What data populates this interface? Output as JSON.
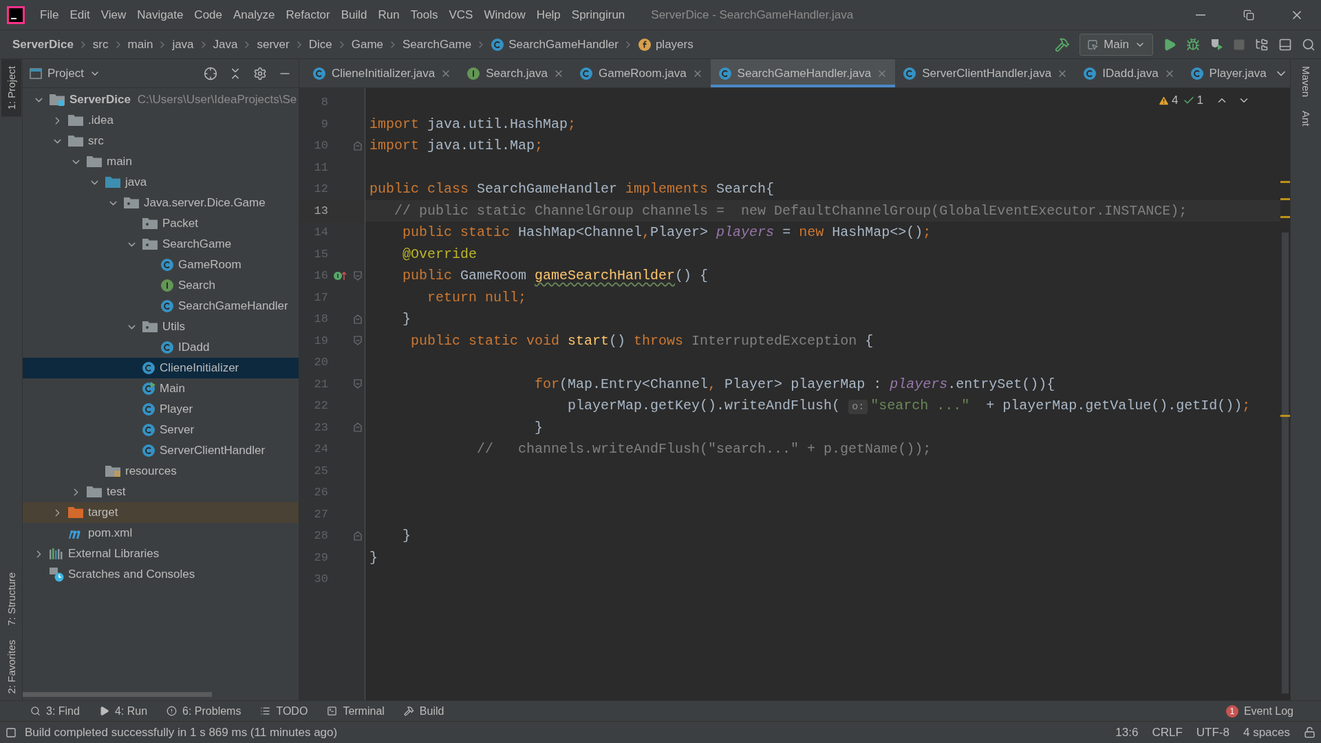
{
  "window": {
    "title": "ServerDice - SearchGameHandler.java"
  },
  "menu": [
    "File",
    "Edit",
    "View",
    "Navigate",
    "Code",
    "Analyze",
    "Refactor",
    "Build",
    "Run",
    "Tools",
    "VCS",
    "Window",
    "Help",
    "Springirun"
  ],
  "breadcrumbs": [
    {
      "label": "ServerDice",
      "kind": "project"
    },
    {
      "label": "src",
      "kind": "folder"
    },
    {
      "label": "main",
      "kind": "folder"
    },
    {
      "label": "java",
      "kind": "folder"
    },
    {
      "label": "Java",
      "kind": "folder"
    },
    {
      "label": "server",
      "kind": "folder"
    },
    {
      "label": "Dice",
      "kind": "folder"
    },
    {
      "label": "Game",
      "kind": "folder"
    },
    {
      "label": "SearchGame",
      "kind": "folder"
    },
    {
      "label": "SearchGameHandler",
      "kind": "class"
    },
    {
      "label": "players",
      "kind": "field"
    }
  ],
  "run_config": "Main",
  "left_strip": [
    {
      "label": "1: Project",
      "selected": true
    },
    {
      "label": "7: Structure",
      "selected": false
    },
    {
      "label": "2: Favorites",
      "selected": false
    }
  ],
  "right_strip": [
    "Maven",
    "Ant"
  ],
  "project_panel": {
    "title": "Project",
    "tree": [
      {
        "label": "ServerDice",
        "path": "C:\\Users\\User\\IdeaProjects\\Se",
        "kind": "module",
        "expanded": true,
        "selected": false,
        "children": [
          {
            "label": ".idea",
            "kind": "folder",
            "expanded": false,
            "selected": false
          },
          {
            "label": "src",
            "kind": "folder",
            "expanded": true,
            "selected": false,
            "children": [
              {
                "label": "main",
                "kind": "folder",
                "expanded": true,
                "selected": false,
                "children": [
                  {
                    "label": "java",
                    "kind": "source",
                    "expanded": true,
                    "selected": false,
                    "children": [
                      {
                        "label": "Java.server.Dice.Game",
                        "kind": "package",
                        "expanded": true,
                        "selected": false,
                        "children": [
                          {
                            "label": "Packet",
                            "kind": "package",
                            "selected": false
                          },
                          {
                            "label": "SearchGame",
                            "kind": "package",
                            "expanded": true,
                            "selected": false,
                            "children": [
                              {
                                "label": "GameRoom",
                                "kind": "class",
                                "selected": false
                              },
                              {
                                "label": "Search",
                                "kind": "interface",
                                "selected": false
                              },
                              {
                                "label": "SearchGameHandler",
                                "kind": "class",
                                "selected": false
                              }
                            ]
                          },
                          {
                            "label": "Utils",
                            "kind": "package",
                            "expanded": true,
                            "selected": false,
                            "children": [
                              {
                                "label": "IDadd",
                                "kind": "class",
                                "selected": false
                              }
                            ]
                          },
                          {
                            "label": "ClieneInitializer",
                            "kind": "class",
                            "selected": true
                          },
                          {
                            "label": "Main",
                            "kind": "main",
                            "selected": false
                          },
                          {
                            "label": "Player",
                            "kind": "class",
                            "selected": false
                          },
                          {
                            "label": "Server",
                            "kind": "class",
                            "selected": false
                          },
                          {
                            "label": "ServerClientHandler",
                            "kind": "class",
                            "selected": false
                          }
                        ]
                      }
                    ]
                  },
                  {
                    "label": "resources",
                    "kind": "resources",
                    "selected": false
                  }
                ]
              },
              {
                "label": "test",
                "kind": "folder",
                "expanded": false,
                "selected": false
              }
            ]
          },
          {
            "label": "target",
            "kind": "excluded",
            "expanded": false,
            "selected": false
          },
          {
            "label": "pom.xml",
            "kind": "maven",
            "selected": false
          }
        ]
      },
      {
        "label": "External Libraries",
        "kind": "libraries",
        "expanded": false,
        "selected": false
      },
      {
        "label": "Scratches and Consoles",
        "kind": "scratches",
        "selected": false
      }
    ]
  },
  "tabs": [
    {
      "label": "ClieneInitializer.java",
      "kind": "class",
      "selected": false,
      "closable": true
    },
    {
      "label": "Search.java",
      "kind": "interface",
      "selected": false,
      "closable": true
    },
    {
      "label": "GameRoom.java",
      "kind": "class",
      "selected": false,
      "closable": true
    },
    {
      "label": "SearchGameHandler.java",
      "kind": "class",
      "selected": true,
      "closable": true
    },
    {
      "label": "ServerClientHandler.java",
      "kind": "class",
      "selected": false,
      "closable": true
    },
    {
      "label": "IDadd.java",
      "kind": "class",
      "selected": false,
      "closable": true
    },
    {
      "label": "Player.java",
      "kind": "class",
      "selected": false,
      "closable": false
    }
  ],
  "editor": {
    "warnings": "4",
    "weak_warnings": "1",
    "lines": [
      {
        "number": "8",
        "current": false
      },
      {
        "number": "9",
        "current": false,
        "tokens": [
          {
            "text": "import",
            "kind": "kw"
          },
          {
            "text": " java.util.HashMap",
            "kind": "plain"
          },
          {
            "text": ";",
            "kind": "kw"
          }
        ]
      },
      {
        "number": "10",
        "current": false,
        "fold": {
          "kind": "end"
        },
        "tokens": [
          {
            "text": "import",
            "kind": "kw"
          },
          {
            "text": " java.util.Map",
            "kind": "plain"
          },
          {
            "text": ";",
            "kind": "kw"
          }
        ]
      },
      {
        "number": "11",
        "current": false
      },
      {
        "number": "12",
        "current": false,
        "tokens": [
          {
            "text": "public class",
            "kind": "kw"
          },
          {
            "text": " SearchGameHandler ",
            "kind": "plain"
          },
          {
            "text": "implements",
            "kind": "kw"
          },
          {
            "text": " Search{",
            "kind": "plain"
          }
        ]
      },
      {
        "number": "13",
        "current": true,
        "tokens": [
          {
            "text": "   // public static ChannelGroup channels =  new DefaultChannelGroup(GlobalEventExecutor.INSTANCE);",
            "kind": "comment"
          }
        ]
      },
      {
        "number": "14",
        "current": false,
        "tokens": [
          {
            "text": "    public static",
            "kind": "kw"
          },
          {
            "text": " HashMap<Channel",
            "kind": "plain"
          },
          {
            "text": ",",
            "kind": "kw"
          },
          {
            "text": "Player> ",
            "kind": "plain"
          },
          {
            "text": "players",
            "kind": "field"
          },
          {
            "text": " = ",
            "kind": "plain"
          },
          {
            "text": "new",
            "kind": "kw"
          },
          {
            "text": " HashMap<>()",
            "kind": "plain"
          },
          {
            "text": ";",
            "kind": "kw"
          }
        ]
      },
      {
        "number": "15",
        "current": false,
        "tokens": [
          {
            "text": "    @Override",
            "kind": "annotation"
          }
        ]
      },
      {
        "number": "16",
        "current": false,
        "fold": {
          "kind": "start"
        },
        "marker": {
          "kind": "implements"
        },
        "tokens": [
          {
            "text": "    public",
            "kind": "kw"
          },
          {
            "text": " GameRoom ",
            "kind": "plain"
          },
          {
            "text": "gameSearchHanlder",
            "kind": "typo-method"
          },
          {
            "text": "() {",
            "kind": "plain"
          }
        ]
      },
      {
        "number": "17",
        "current": false,
        "tokens": [
          {
            "text": "       return null;",
            "kind": "kw"
          }
        ]
      },
      {
        "number": "18",
        "current": false,
        "fold": {
          "kind": "end"
        },
        "tokens": [
          {
            "text": "    }",
            "kind": "plain"
          }
        ]
      },
      {
        "number": "19",
        "current": false,
        "fold": {
          "kind": "start"
        },
        "tokens": [
          {
            "text": "     public static void ",
            "kind": "kw"
          },
          {
            "text": "start",
            "kind": "method"
          },
          {
            "text": "() ",
            "kind": "plain"
          },
          {
            "text": "throws",
            "kind": "kw"
          },
          {
            "text": " InterruptedException",
            "kind": "muted"
          },
          {
            "text": " {",
            "kind": "plain"
          }
        ]
      },
      {
        "number": "20",
        "current": false
      },
      {
        "number": "21",
        "current": false,
        "fold": {
          "kind": "start"
        },
        "tokens": [
          {
            "text": "                    for",
            "kind": "kw"
          },
          {
            "text": "(Map.Entry<Channel",
            "kind": "plain"
          },
          {
            "text": ",",
            "kind": "kw"
          },
          {
            "text": " Player> playerMap : ",
            "kind": "plain"
          },
          {
            "text": "players",
            "kind": "field"
          },
          {
            "text": ".entrySet()){",
            "kind": "plain"
          }
        ]
      },
      {
        "number": "22",
        "current": false,
        "tokens": [
          {
            "text": "                        playerMap.getKey().writeAndFlush( ",
            "kind": "plain"
          },
          {
            "text": "o:",
            "kind": "hint"
          },
          {
            "text": "\"search ...\"",
            "kind": "string"
          },
          {
            "text": "  + playerMap.getValue().getId())",
            "kind": "plain"
          },
          {
            "text": ";",
            "kind": "kw"
          }
        ]
      },
      {
        "number": "23",
        "current": false,
        "fold": {
          "kind": "end"
        },
        "tokens": [
          {
            "text": "                    }",
            "kind": "plain"
          }
        ]
      },
      {
        "number": "24",
        "current": false,
        "tokens": [
          {
            "text": "             //   channels.writeAndFlush(\"search...\" + p.getName());",
            "kind": "comment"
          }
        ]
      },
      {
        "number": "25",
        "current": false
      },
      {
        "number": "26",
        "current": false
      },
      {
        "number": "27",
        "current": false
      },
      {
        "number": "28",
        "current": false,
        "fold": {
          "kind": "end"
        },
        "tokens": [
          {
            "text": "    }",
            "kind": "plain"
          }
        ]
      },
      {
        "number": "29",
        "current": false,
        "tokens": [
          {
            "text": "}",
            "kind": "plain"
          }
        ]
      },
      {
        "number": "30",
        "current": false
      }
    ]
  },
  "tool_windows": [
    {
      "label": "3: Find",
      "kind": "find"
    },
    {
      "label": "4: Run",
      "kind": "run"
    },
    {
      "label": "6: Problems",
      "kind": "problems"
    },
    {
      "label": "TODO",
      "kind": "todo"
    },
    {
      "label": "Terminal",
      "kind": "terminal"
    },
    {
      "label": "Build",
      "kind": "build"
    }
  ],
  "event_log": {
    "label": "Event Log",
    "count": "1"
  },
  "status_bar": {
    "message": "Build completed successfully in 1 s 869 ms (11 minutes ago)",
    "items": [
      "13:6",
      "CRLF",
      "UTF-8",
      "4 spaces"
    ]
  }
}
